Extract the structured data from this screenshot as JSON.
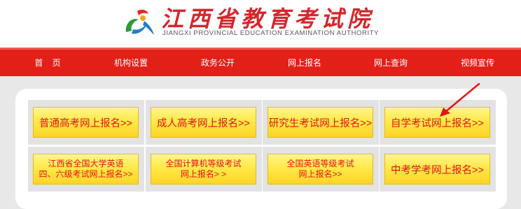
{
  "header": {
    "title_cn": "江西省教育考试院",
    "title_en": "JIANGXI PROVINCIAL EDUCATION EXAMINATION AUTHORITY"
  },
  "nav": {
    "items": [
      {
        "label": "首    页"
      },
      {
        "label": "机构设置"
      },
      {
        "label": "政务公开"
      },
      {
        "label": "网上报名"
      },
      {
        "label": "网上查询"
      },
      {
        "label": "视频宣传"
      }
    ]
  },
  "buttons": [
    {
      "label": "普通高考网上报名>>"
    },
    {
      "label": "成人高考网上报名>>"
    },
    {
      "label": "研究生考试网上报名>>"
    },
    {
      "label": "自学考试网上报名>>"
    },
    {
      "label": "江西省全国大学英语\n四、六级考试网上报名>>"
    },
    {
      "label": "全国计算机等级考试\n网上报名> >"
    },
    {
      "label": "全国英语等级考试\n网上报名>>"
    },
    {
      "label": "中考学考网上报名>>"
    }
  ],
  "colors": {
    "brand_red": "#e22018",
    "button_text": "#e3141a",
    "button_yellow": "#ffe94a",
    "annotation_arrow": "#e3141a"
  }
}
